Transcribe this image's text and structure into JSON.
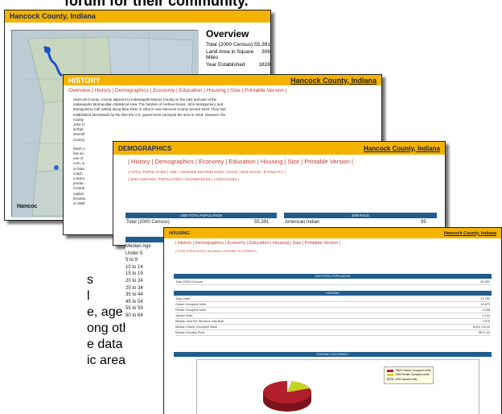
{
  "background": {
    "top_fragment": "forum for their community.",
    "left_fragments": [
      "s",
      "l",
      "e, age",
      "ong others,",
      "e data easily",
      "ic area to"
    ]
  },
  "overview_card": {
    "title": "Hancock County, Indiana",
    "heading": "Overview",
    "rows": [
      {
        "label": "Total (2000 Census):",
        "value": "55,391"
      },
      {
        "label": "Land Area in Square Miles",
        "value": "306"
      },
      {
        "label": "Year Established",
        "value": "1828"
      }
    ],
    "map_caption": "Hancoc"
  },
  "history_card": {
    "left_title": "HISTORY",
    "right_title": "Hancock County, Indiana",
    "nav": [
      "Overview",
      "History",
      "Demographics",
      "Economy",
      "Education",
      "Housing",
      "Size",
      "Printable Version"
    ],
    "body": [
      "Hancock County. County adjacent to Indianapolis-Marion County on the east and part of the",
      "Indianapolis Metropolitan Statistical Area. The families of Andrew Evans, John Montgomery, and",
      "Montgomery Call settled along Blue River in what is now Hancock County around 1818. They had",
      "established farmsteads by the time the U.S. government surveyed the area in 1819. However, the",
      "county",
      "John H",
      "at that",
      "Greenfi",
      "County",
      "Much o",
      "lots an",
      "use of",
      "corn, w",
      "or bran",
      "coach",
      "constru",
      "produc",
      "Central",
      "capital",
      "became",
      "in 1900"
    ]
  },
  "demographics_card": {
    "left_title": "DEMOGRAPHICS",
    "right_title": "Hancock County, Indiana",
    "nav": [
      "History",
      "Demographics",
      "Economy",
      "Education",
      "Housing",
      "Size",
      "Printable Version"
    ],
    "subnav": [
      "TOTAL POPULATION",
      "AGE",
      "GENDER DISTRIBUTION",
      "RACE",
      "2000 RACE",
      "ETHNICITY",
      "2000 HISPANIC POPULATION",
      "HOUSEHOLDS",
      "LANGUAGES"
    ],
    "table_left_header": "2000 TOTAL POPULATION",
    "table_left_label": "Total (2000 Census)",
    "table_left_value": "55,391",
    "table_right_header": "2000 RACE",
    "table_right_label": "American Indian",
    "table_right_value": "95",
    "age_labels": [
      "Median Age",
      "Under 5",
      "5 to 9",
      "10 to 14",
      "15 to 19",
      "20 to 24",
      "25 to 34",
      "35 to 44",
      "45 to 54",
      "55 to 59",
      "60 to 64"
    ]
  },
  "housing_card": {
    "left_title": "HOUSING",
    "right_title": "Hancock County, Indiana",
    "nav": [
      "History",
      "Demographics",
      "Economy",
      "Education",
      "Housing",
      "Size",
      "Printable Version"
    ],
    "subnav": [
      "TOTAL POPULATION",
      "HOUSING",
      "HOUSING OCCUPANCY"
    ],
    "h1": "2000 TOTAL POPULATION",
    "pop_row": {
      "label": "Total (2000 Census)",
      "value": "55,391"
    },
    "h2": "HOUSING",
    "housing_rows": [
      {
        "label": "Total Units",
        "value": "21,750"
      },
      {
        "label": "Owner Occupied Units",
        "value": "16,873"
      },
      {
        "label": "Renter Occupied Units",
        "value": "4,058"
      },
      {
        "label": "Vacant Units",
        "value": "1,194"
      },
      {
        "label": "Median Year the Structure was Built",
        "value": "1975"
      },
      {
        "label": "Median Owner Occupied Value",
        "value": "$124,744.00"
      },
      {
        "label": "Median Monthly Rent",
        "value": "$571.00"
      }
    ],
    "h3": "HOUSING OCCUPANCY",
    "legend": [
      {
        "label": "78875 Owner Occupied Units",
        "color": "#b1202a"
      },
      {
        "label": "1896 Renter Occupied Units",
        "color": "#c7d41e"
      },
      {
        "label": "1194 Vacant Units",
        "color": "#ffffff"
      }
    ]
  }
}
